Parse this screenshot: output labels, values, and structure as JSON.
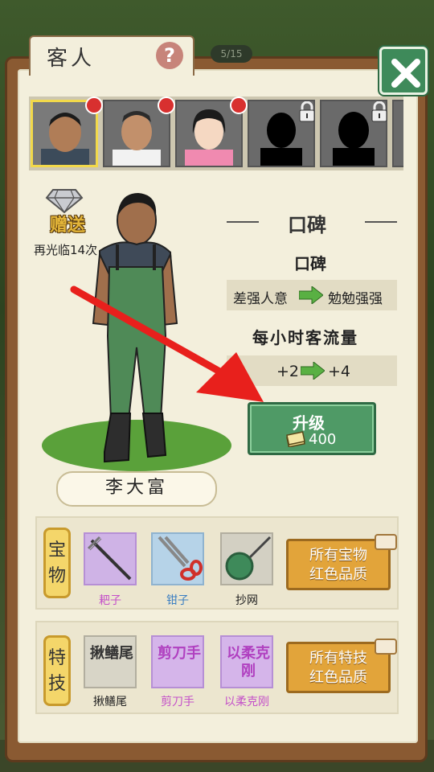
{
  "title": "客人",
  "help_label": "?",
  "customer_count": "5/15",
  "customers": [
    {
      "name": "customer-1",
      "selected": true,
      "has_dot": true
    },
    {
      "name": "customer-2",
      "has_dot": true
    },
    {
      "name": "customer-3",
      "has_dot": true
    },
    {
      "name": "customer-4",
      "locked": true
    },
    {
      "name": "customer-5",
      "locked": true
    }
  ],
  "gift": {
    "label": "赠送",
    "sub": "再光临14次"
  },
  "reputation": {
    "header": "口碑",
    "label": "口碑",
    "from": "差强人意",
    "to": "勉勉强强"
  },
  "traffic": {
    "label": "每小时客流量",
    "from": "+2",
    "to": "+4"
  },
  "upgrade": {
    "label": "升级",
    "cost": "400"
  },
  "character_name": "李大富",
  "treasure": {
    "tag": "宝物",
    "items": [
      {
        "label": "耙子",
        "color": "#c451c9"
      },
      {
        "label": "钳子",
        "color": "#3b7fc2"
      },
      {
        "label": "抄网",
        "color": "#222222"
      }
    ],
    "action": "所有宝物红色品质"
  },
  "skills": {
    "tag": "特技",
    "items": [
      {
        "icon_text": "揪鳝尾",
        "label": "揪鳝尾",
        "color": "#222222"
      },
      {
        "icon_text": "剪刀手",
        "label": "剪刀手",
        "color": "#c451c9"
      },
      {
        "icon_text": "以柔克刚",
        "label": "以柔克刚",
        "color": "#c451c9"
      }
    ],
    "action": "所有特技红色品质"
  },
  "colors": {
    "accent_green": "#4f9a66",
    "gold": "#e2a43a",
    "paper": "#f3efdc",
    "red_arrow": "#e8201c"
  }
}
